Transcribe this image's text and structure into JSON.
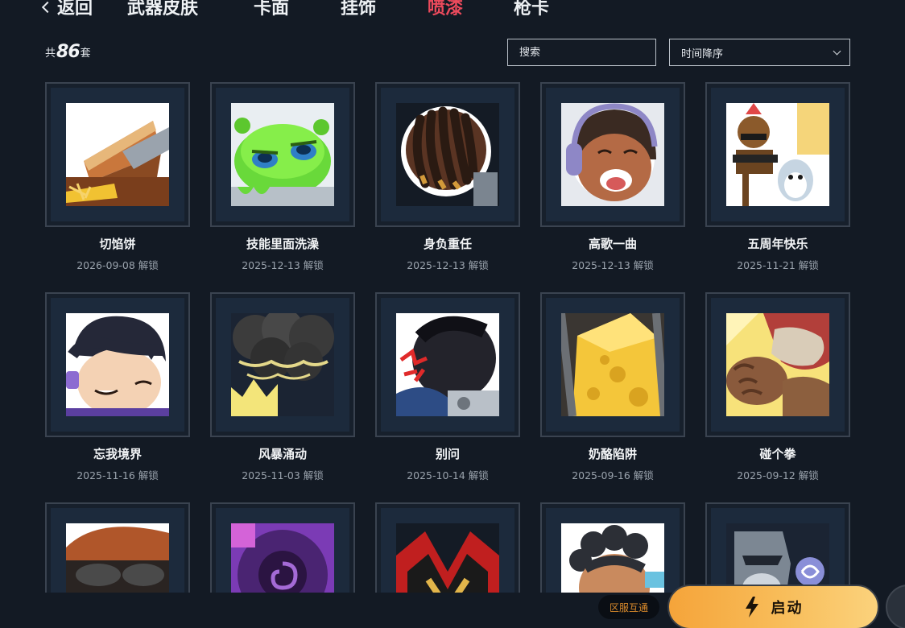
{
  "nav": {
    "back_label": "返回",
    "tabs": [
      {
        "label": "武器皮肤",
        "active": false
      },
      {
        "label": "卡面",
        "active": false
      },
      {
        "label": "挂饰",
        "active": false
      },
      {
        "label": "喷漆",
        "active": true
      },
      {
        "label": "枪卡",
        "active": false
      }
    ],
    "active_color": "#ec4a5c"
  },
  "toolbar": {
    "count_prefix": "共",
    "count": "86",
    "count_suffix": "套",
    "search_placeholder": "搜索",
    "sort_value": "时间降序"
  },
  "sprays": [
    {
      "name": "切馅饼",
      "date": "2026-09-08 解锁",
      "art": "pie"
    },
    {
      "name": "技能里面洗澡",
      "date": "2025-12-13 解锁",
      "art": "slime"
    },
    {
      "name": "身负重任",
      "date": "2025-12-13 解锁",
      "art": "dreads"
    },
    {
      "name": "高歌一曲",
      "date": "2025-12-13 解锁",
      "art": "singer"
    },
    {
      "name": "五周年快乐",
      "date": "2025-11-21 解锁",
      "art": "anniversary"
    },
    {
      "name": "忘我境界",
      "date": "2025-11-16 解锁",
      "art": "boy"
    },
    {
      "name": "风暴涌动",
      "date": "2025-11-03 解锁",
      "art": "storm"
    },
    {
      "name": "别问",
      "date": "2025-10-14 解锁",
      "art": "angry"
    },
    {
      "name": "奶酪陷阱",
      "date": "2025-09-16 解锁",
      "art": "cheese"
    },
    {
      "name": "碰个拳",
      "date": "2025-09-12 解锁",
      "art": "fist"
    },
    {
      "name": "",
      "date": "",
      "art": "goggles"
    },
    {
      "name": "",
      "date": "",
      "art": "purple"
    },
    {
      "name": "",
      "date": "",
      "art": "mask"
    },
    {
      "name": "",
      "date": "",
      "art": "curly"
    },
    {
      "name": "",
      "date": "",
      "art": "knight"
    }
  ],
  "footer": {
    "region_label": "区服互通",
    "launch_label": "启动"
  }
}
